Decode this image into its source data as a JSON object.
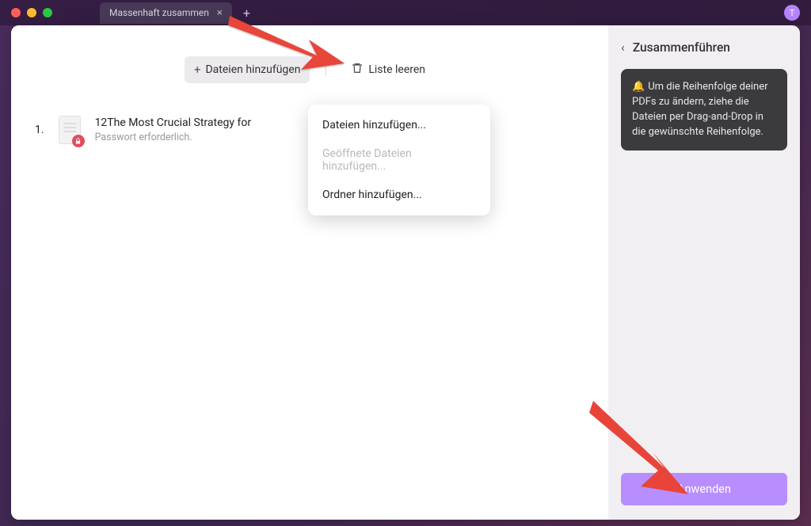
{
  "titlebar": {
    "tab_title": "Massenhaft zusammen",
    "avatar_letter": "T"
  },
  "toolbar": {
    "add_label": "Dateien hinzufügen",
    "clear_label": "Liste leeren"
  },
  "dropdown": {
    "items": [
      {
        "label": "Dateien hinzufügen...",
        "disabled": false
      },
      {
        "label": "Geöffnete Dateien hinzufügen...",
        "disabled": true
      },
      {
        "label": "Ordner hinzufügen...",
        "disabled": false
      }
    ]
  },
  "files": [
    {
      "index": "1.",
      "name": "12The Most Crucial Strategy for",
      "sub": "Passwort erforderlich."
    }
  ],
  "sidepanel": {
    "title": "Zusammenführen",
    "tip_emoji": "🔔",
    "tip_text": "Um die Reihenfolge deiner PDFs zu ändern, ziehe die Dateien per Drag-and-Drop in die gewünschte Reihenfolge.",
    "apply_label": "Anwenden"
  }
}
